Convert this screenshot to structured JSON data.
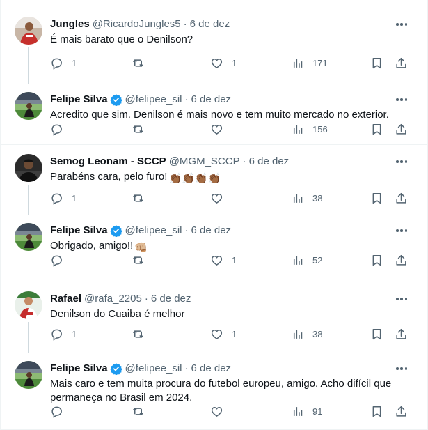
{
  "colors": {
    "text": "#0f1419",
    "secondary": "#536471",
    "verified": "#1d9bf0",
    "connector": "#cfd9de",
    "divider": "#eff3f4"
  },
  "icons": [
    "reply-icon",
    "retweet-icon",
    "like-icon",
    "views-icon",
    "bookmark-icon",
    "share-icon",
    "more-icon",
    "verified-badge-icon"
  ],
  "threads": [
    {
      "reply": {
        "name": "Jungles",
        "handle": "@RicardoJungles5",
        "time": "6 de dez",
        "text": "É mais barato que o Denilson?",
        "replies": "1",
        "retweets": "",
        "likes": "1",
        "views": "171"
      },
      "answer": {
        "name": "Felipe Silva",
        "handle": "@felipee_sil",
        "time": "6 de dez",
        "text": "Acredito que sim. Denilson é mais novo e tem muito mercado no exterior.",
        "replies": "",
        "retweets": "",
        "likes": "",
        "views": "156"
      }
    },
    {
      "reply": {
        "name": "Semog Leonam - SCCP",
        "handle": "@MGM_SCCP",
        "time": "6 de dez",
        "text": "Parabéns cara, pelo furo!",
        "emoji": "👏🏾👏🏾👏🏾👏🏾",
        "replies": "1",
        "retweets": "",
        "likes": "",
        "views": "38"
      },
      "answer": {
        "name": "Felipe Silva",
        "handle": "@felipee_sil",
        "time": "6 de dez",
        "text": "Obrigado, amigo!!",
        "emoji": "👊🏼",
        "replies": "",
        "retweets": "",
        "likes": "1",
        "views": "52"
      }
    },
    {
      "reply": {
        "name": "Rafael",
        "handle": "@rafa_2205",
        "time": "6 de dez",
        "text": "Denilson do Cuaiba é melhor",
        "replies": "1",
        "retweets": "",
        "likes": "1",
        "views": "38"
      },
      "answer": {
        "name": "Felipe Silva",
        "handle": "@felipee_sil",
        "time": "6 de dez",
        "text": "Mais caro e tem muita procura do futebol europeu, amigo. Acho difícil que permaneça no Brasil em 2024.",
        "replies": "",
        "retweets": "",
        "likes": "",
        "views": "91"
      }
    }
  ]
}
